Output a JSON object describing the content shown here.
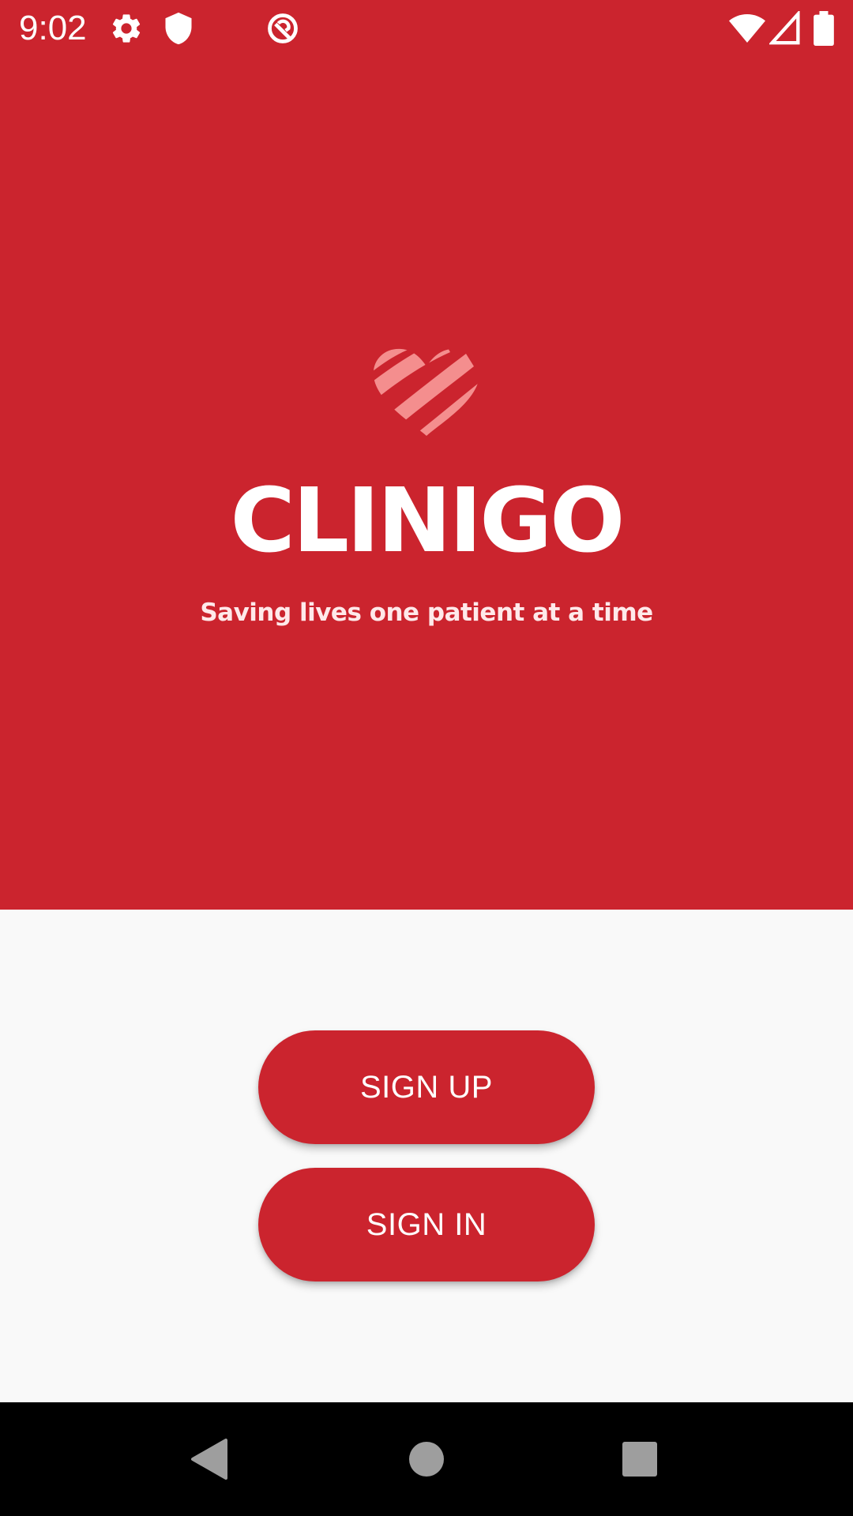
{
  "status_bar": {
    "time": "9:02",
    "icons_left": [
      "settings-icon",
      "shield-icon",
      "no-location-icon"
    ],
    "icons_right": [
      "wifi-icon",
      "signal-icon",
      "battery-icon"
    ]
  },
  "brand": {
    "logo_icon": "striped-heart-icon",
    "app_name": "CLINIGO",
    "tagline": "Saving lives one patient at a time"
  },
  "actions": {
    "sign_up_label": "SIGN UP",
    "sign_in_label": "SIGN IN"
  },
  "nav_bar": {
    "buttons": [
      "back-icon",
      "home-icon",
      "recents-icon"
    ]
  },
  "colors": {
    "primary": "#cb242e",
    "background": "#f9f9f9",
    "logo_stripe": "#f48e8e",
    "nav_bar": "#000000",
    "nav_icon": "#9e9e9e"
  }
}
